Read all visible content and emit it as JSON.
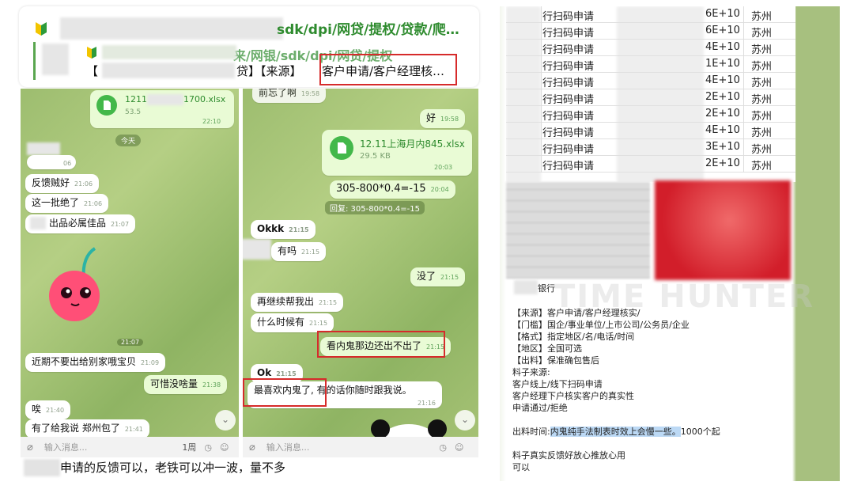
{
  "header": {
    "line1": "sdk/dpi/网贷/提权/贷款/爬…",
    "line2": "来/网银/sdk/dpi/网贷/提权",
    "line3_a": "【",
    "line3_b": "贷】【来源】",
    "line3_c": "客户申请/客户经理核…"
  },
  "chat_left": {
    "file_name": "1211",
    "file_name_tail": "1700.xlsx",
    "file_size": "53.5",
    "file_time": "22:10",
    "date_badge": "今天",
    "messages": [
      {
        "text": "06",
        "time": ""
      },
      {
        "text": "反馈贼好",
        "time": "21:06"
      },
      {
        "text": "这一批绝了",
        "time": "21:06"
      },
      {
        "text": "出品必属佳品",
        "time": "21:07"
      },
      {
        "text": "近期不要出给别家哦宝贝",
        "time": "21:09"
      },
      {
        "text": "唉",
        "time": "21:40"
      },
      {
        "text": "有了给我说 郑州包了",
        "time": "21:41"
      }
    ],
    "sticker_time": "21:07",
    "out_message": {
      "text": "可惜没啥量",
      "time": "21:38"
    },
    "input_placeholder": "输入消息...",
    "input_extra": "1周"
  },
  "chat_mid": {
    "top_partial": {
      "text": "前忘了啊",
      "time": "19:58"
    },
    "out_good": {
      "text": "好",
      "time": "19:58"
    },
    "file_name": "12.11上海月内845.xlsx",
    "file_size": "29.5 KB",
    "file_time": "20:03",
    "calc": {
      "text": "305-800*0.4=-15",
      "time": "20:04"
    },
    "calc_reply": "回复: 305-800*0.4=-15",
    "okkk": {
      "text": "Okkk",
      "time": "21:15"
    },
    "have": {
      "text": "有吗",
      "time": "21:15"
    },
    "no": {
      "text": "没了",
      "time": "21:15"
    },
    "continue": {
      "text": "再继续帮我出",
      "time": "21:15"
    },
    "when": {
      "text": "什么时候有",
      "time": "21:15"
    },
    "insider": {
      "text": "看内鬼那边还出不出了",
      "time": "21:15"
    },
    "ok": {
      "text": "Ok",
      "time": "21:15"
    },
    "love_a": "最喜欢内鬼了,",
    "love_b": "有的话你随时跟我说。",
    "love_time": "21:16",
    "input_placeholder": "输入消息..."
  },
  "caption": "申请的反馈可以，老铁可以冲一波，量不多",
  "table": {
    "rows": [
      {
        "c1": "行扫码申请",
        "c2": "6E+10",
        "c3": "苏州"
      },
      {
        "c1": "行扫码申请",
        "c2": "6E+10",
        "c3": "苏州"
      },
      {
        "c1": "行扫码申请",
        "c2": "4E+10",
        "c3": "苏州"
      },
      {
        "c1": "行扫码申请",
        "c2": "1E+10",
        "c3": "苏州"
      },
      {
        "c1": "行扫码申请",
        "c2": "4E+10",
        "c3": "苏州"
      },
      {
        "c1": "行扫码申请",
        "c2": "2E+10",
        "c3": "苏州"
      },
      {
        "c1": "行扫码申请",
        "c2": "2E+10",
        "c3": "苏州"
      },
      {
        "c1": "行扫码申请",
        "c2": "4E+10",
        "c3": "苏州"
      },
      {
        "c1": "行扫码申请",
        "c2": "3E+10",
        "c3": "苏州"
      },
      {
        "c1": "行扫码申请",
        "c2": "2E+10",
        "c3": "苏州"
      }
    ]
  },
  "doc": {
    "bank": "银行",
    "lines": [
      "【来源】客户申请/客户经理核实/",
      "【门槛】国企/事业单位/上市公司/公务员/企业",
      "【格式】指定地区/名/电话/时间",
      "【地区】全国可选",
      "【出料】保准确包售后",
      "料子来源:",
      "客户线上/线下扫码申请",
      "客户经理下户核实客户的真实性",
      "申请通过/拒绝"
    ],
    "time_label": "出料时间:",
    "time_highlight": "内鬼纯手法制表时效上会慢一些。",
    "time_tail": "1000个起",
    "feedback": "料子真实反馈好放心推放心用",
    "ok": "可以"
  },
  "watermark": "TIME HUNTER",
  "colors": {
    "red_box": "#d62b2b",
    "out_bubble": "#e9fbd5",
    "green_text": "#2e8b2e",
    "highlight": "#bcd9f5"
  }
}
